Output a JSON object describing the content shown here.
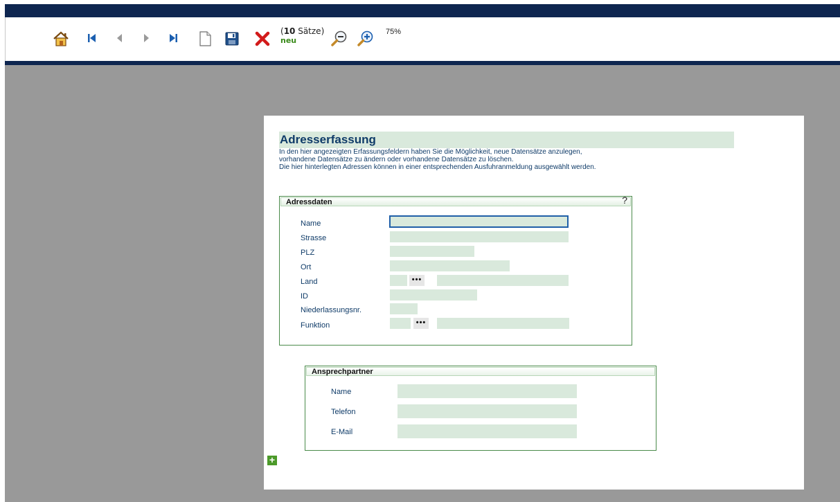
{
  "toolbar": {
    "icons": [
      "home-icon",
      "first-record-icon",
      "previous-record-icon",
      "next-record-icon",
      "last-record-icon",
      "new-document-icon",
      "save-icon",
      "delete-icon",
      "zoom-out-icon",
      "zoom-in-icon"
    ],
    "record_count_open": "(",
    "record_count_number": "10",
    "record_count_label": " Sätze)",
    "status": "neu",
    "zoom": "75%"
  },
  "page": {
    "title": "Adresserfassung",
    "description_lines": [
      "In den hier angezeigten Erfassungsfeldern haben Sie die Möglichkeit, neue Datensätze anzulegen,",
      "vorhandene Datensätze zu ändern oder vorhandene Datensätze zu löschen.",
      "Die hier hinterlegten Adressen können in einer entsprechenden Ausfuhranmeldung ausgewählt werden."
    ]
  },
  "adressdaten": {
    "heading": "Adressdaten",
    "help": "?",
    "labels": {
      "name": "Name",
      "strasse": "Strasse",
      "plz": "PLZ",
      "ort": "Ort",
      "land": "Land",
      "id": "ID",
      "niederlassung": "Niederlassungsnr.",
      "funktion": "Funktion"
    },
    "lookup_button": "•••"
  },
  "ansprechpartner": {
    "heading": "Ansprechpartner",
    "labels": {
      "name": "Name",
      "telefon": "Telefon",
      "email": "E-Mail"
    }
  },
  "add_button": "+",
  "colors": {
    "navy": "#0e2650",
    "field": "#d9e9dc",
    "title_text": "#0f3b68",
    "border_green": "#4a8a4a",
    "accent_green": "#4c9a2a",
    "delete_red": "#d21a1a"
  }
}
